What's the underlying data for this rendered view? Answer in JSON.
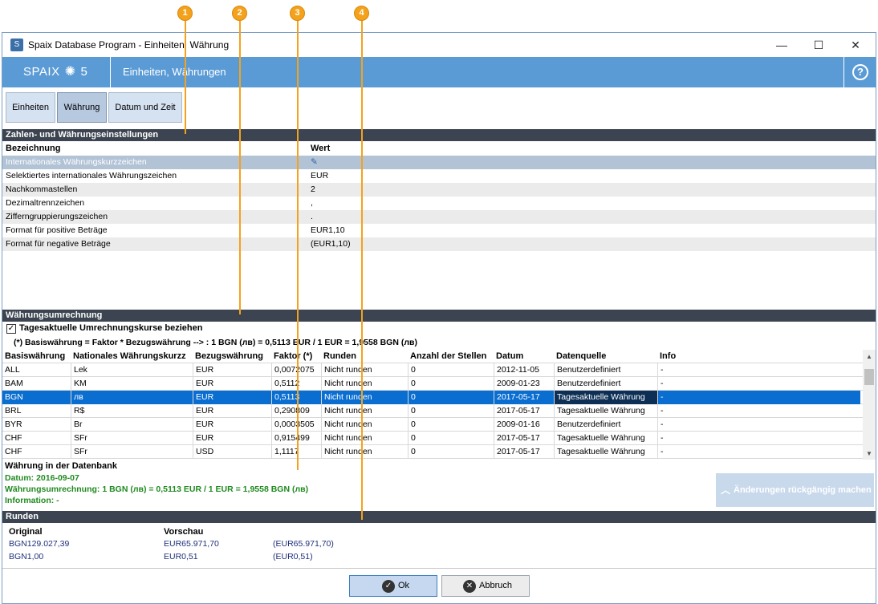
{
  "callouts": [
    "1",
    "2",
    "3",
    "4"
  ],
  "window": {
    "title": "Spaix Database Program - Einheiten, Währung",
    "minimize": "—",
    "maximize": "☐",
    "close": "✕"
  },
  "header": {
    "logo_text": "SPAIX",
    "logo_version": "5",
    "title": "Einheiten, Währungen",
    "help": "?"
  },
  "tabs": [
    {
      "label": "Einheiten"
    },
    {
      "label": "Währung"
    },
    {
      "label": "Datum und Zeit"
    }
  ],
  "settings": {
    "section_title": "Zahlen- und Währungseinstellungen",
    "col_name": "Bezeichnung",
    "col_value": "Wert",
    "rows": [
      {
        "name": "Internationales Währungskurzzeichen",
        "value": "✎"
      },
      {
        "name": "Selektiertes internationales Währungszeichen",
        "value": "EUR"
      },
      {
        "name": "Nachkommastellen",
        "value": "2"
      },
      {
        "name": "Dezimaltrennzeichen",
        "value": ","
      },
      {
        "name": "Zifferngruppierungszeichen",
        "value": "."
      },
      {
        "name": "Format für positive Beträge",
        "value": "EUR1,10"
      },
      {
        "name": "Format für negative Beträge",
        "value": "(EUR1,10)"
      }
    ]
  },
  "conversion": {
    "section_title": "Währungsumrechnung",
    "checkbox_label": "Tagesaktuelle Umrechnungskurse beziehen",
    "checkbox_checked": true,
    "formula": "(*)  Basiswährung = Faktor * Bezugswährung --> : 1 BGN (лв) = 0,5113 EUR  /   1 EUR = 1,9558 BGN (лв)",
    "headers": [
      "Basiswährung",
      "Nationales Währungskurzz",
      "Bezugswährung",
      "Faktor (*)",
      "Runden",
      "Anzahl der Stellen",
      "Datum",
      "Datenquelle",
      "Info"
    ],
    "rows": [
      [
        "ALL",
        "Lek",
        "EUR",
        "0,0072075",
        "Nicht runden",
        "0",
        "2012-11-05",
        "Benutzerdefiniert",
        "-"
      ],
      [
        "BAM",
        "KM",
        "EUR",
        "0,5112",
        "Nicht runden",
        "0",
        "2009-01-23",
        "Benutzerdefiniert",
        "-"
      ],
      [
        "BGN",
        "лв",
        "EUR",
        "0,5113",
        "Nicht runden",
        "0",
        "2017-05-17",
        "Tagesaktuelle Währung",
        "-"
      ],
      [
        "BRL",
        "R$",
        "EUR",
        "0,290809",
        "Nicht runden",
        "0",
        "2017-05-17",
        "Tagesaktuelle Währung",
        "-"
      ],
      [
        "BYR",
        "Br",
        "EUR",
        "0,0003505",
        "Nicht runden",
        "0",
        "2009-01-16",
        "Benutzerdefiniert",
        "-"
      ],
      [
        "CHF",
        "SFr",
        "EUR",
        "0,915499",
        "Nicht runden",
        "0",
        "2017-05-17",
        "Tagesaktuelle Währung",
        "-"
      ],
      [
        "CHF",
        "SFr",
        "USD",
        "1,1117",
        "Nicht runden",
        "0",
        "2017-05-17",
        "Tagesaktuelle Währung",
        "-"
      ]
    ],
    "selected_row": 2
  },
  "db_info": {
    "title": "Währung in der Datenbank",
    "date": "Datum: 2016-09-07",
    "conversion": "Währungsumrechnung: 1 BGN (лв) = 0,5113 EUR  /   1 EUR = 1,9558 BGN (лв)",
    "information": "Information: -"
  },
  "undo_label": "Änderungen rückgängig machen",
  "rounding": {
    "section_title": "Runden",
    "col_original": "Original",
    "col_preview": "Vorschau",
    "rows": [
      {
        "original": "BGN129.027,39",
        "preview": "EUR65.971,70",
        "negative": "(EUR65.971,70)"
      },
      {
        "original": "BGN1,00",
        "preview": "EUR0,51",
        "negative": "(EUR0,51)"
      }
    ]
  },
  "buttons": {
    "ok": "Ok",
    "cancel": "Abbruch"
  },
  "colors": {
    "header_bg": "#5b9bd5",
    "section_bg": "#3b4450",
    "selected_row": "#0a6ed1",
    "callout": "#f4a21c",
    "info_green": "#1f8a1f"
  }
}
